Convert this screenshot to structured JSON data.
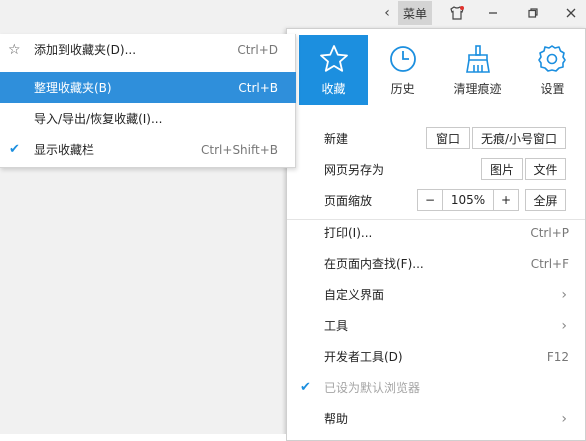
{
  "titlebar": {
    "back_icon": "chevron-left",
    "menu_label": "菜单",
    "skin_icon": "shirt-icon",
    "min_icon": "minimize",
    "restore_icon": "restore",
    "close_icon": "close"
  },
  "main_menu": {
    "icons": [
      {
        "label": "收藏",
        "icon": "star-icon",
        "active": true
      },
      {
        "label": "历史",
        "icon": "clock-icon",
        "active": false
      },
      {
        "label": "清理痕迹",
        "icon": "broom-icon",
        "active": false
      },
      {
        "label": "设置",
        "icon": "gear-icon",
        "active": false
      }
    ],
    "new": {
      "label": "新建",
      "btn1": "窗口",
      "btn2": "无痕/小号窗口"
    },
    "save_as": {
      "label": "网页另存为",
      "btn1": "图片",
      "btn2": "文件"
    },
    "zoom": {
      "label": "页面缩放",
      "minus": "−",
      "value": "105%",
      "plus": "+",
      "full": "全屏"
    },
    "print": {
      "label": "打印(I)...",
      "shortcut": "Ctrl+P"
    },
    "find": {
      "label": "在页面内查找(F)...",
      "shortcut": "Ctrl+F"
    },
    "customize": {
      "label": "自定义界面"
    },
    "tools": {
      "label": "工具"
    },
    "devtools": {
      "label": "开发者工具(D)",
      "shortcut": "F12"
    },
    "default_browser": {
      "label": "已设为默认浏览器"
    },
    "help": {
      "label": "帮助"
    }
  },
  "fav_menu": {
    "items": [
      {
        "label": "添加到收藏夹(D)...",
        "shortcut": "Ctrl+D"
      },
      {
        "label": "整理收藏夹(B)",
        "shortcut": "Ctrl+B"
      },
      {
        "label": "导入/导出/恢复收藏(I)...",
        "shortcut": ""
      },
      {
        "label": "显示收藏栏",
        "shortcut": "Ctrl+Shift+B"
      }
    ]
  },
  "colors": {
    "accent": "#1c8fdf",
    "highlight": "#2f8fdb"
  }
}
